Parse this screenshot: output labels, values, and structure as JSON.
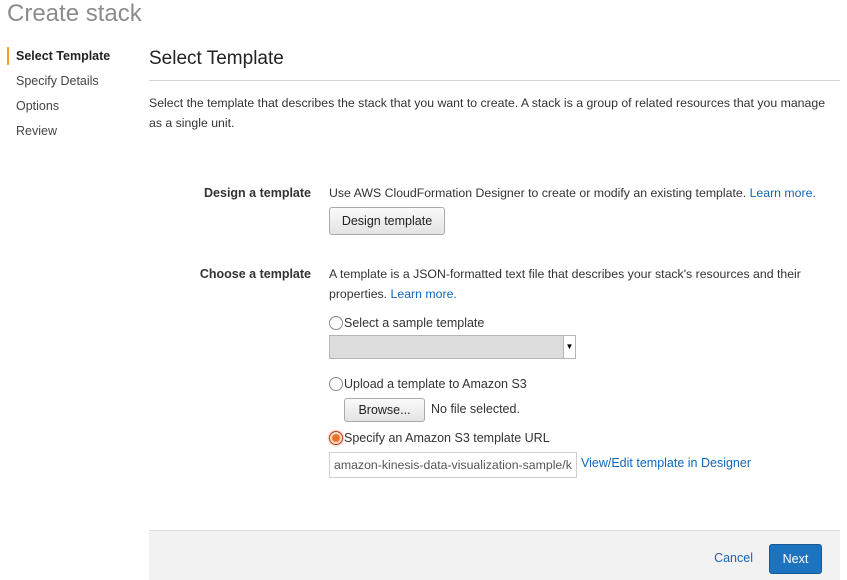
{
  "page": {
    "title": "Create stack"
  },
  "sidebar": {
    "items": [
      {
        "label": "Select Template",
        "active": true
      },
      {
        "label": "Specify Details"
      },
      {
        "label": "Options"
      },
      {
        "label": "Review"
      }
    ]
  },
  "main": {
    "title": "Select Template",
    "description": "Select the template that describes the stack that you want to create. A stack is a group of related resources that you manage as a single unit."
  },
  "design": {
    "label": "Design a template",
    "text": "Use AWS CloudFormation Designer to create or modify an existing template.",
    "learn_more": "Learn more.",
    "button_label": "Design template"
  },
  "choose": {
    "label": "Choose a template",
    "text": "A template is a JSON-formatted text file that describes your stack's resources and their properties.",
    "learn_more": "Learn more.",
    "options": {
      "sample": "Select a sample template",
      "upload": "Upload a template to Amazon S3",
      "url": "Specify an Amazon S3 template URL"
    },
    "selected": "url",
    "sample_select_value": "",
    "browse_label": "Browse...",
    "no_file": "No file selected.",
    "url_value": "amazon-kinesis-data-visualization-sample/k",
    "view_edit_link": "View/Edit template in Designer"
  },
  "footer": {
    "cancel_label": "Cancel",
    "next_label": "Next"
  },
  "colors": {
    "accent": "#f29e1f",
    "link": "#1166bb",
    "primary_button": "#1e73be"
  }
}
